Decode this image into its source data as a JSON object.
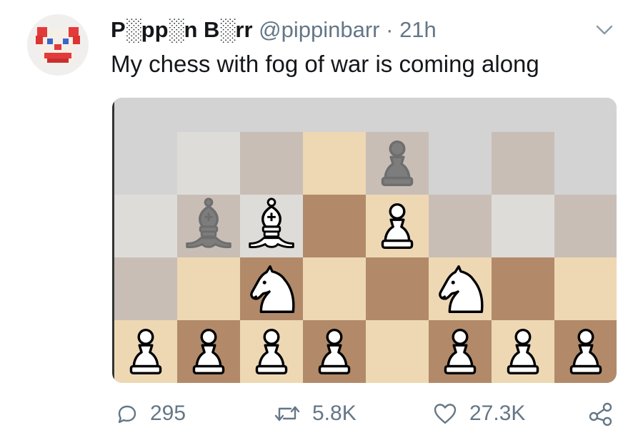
{
  "user": {
    "display_name": "P░pp░n B░rr",
    "handle": "@pippinbarr",
    "separator": "·",
    "time": "21h"
  },
  "tweet": {
    "text": "My chess with fog of war is coming along"
  },
  "board": {
    "squares": [
      [
        "fog",
        "fog",
        "fog",
        "fog",
        "fog",
        "fog",
        "fog",
        "fog"
      ],
      [
        "fog",
        "fog-light",
        "fog-dark",
        "light",
        "fog-dark",
        "fog",
        "fog-dark",
        "fog"
      ],
      [
        "fog-light",
        "fog-dark",
        "fog-light",
        "dark",
        "light",
        "fog-dark",
        "fog-light",
        "fog-dark"
      ],
      [
        "fog-dark",
        "light",
        "dark",
        "light",
        "dark",
        "light",
        "dark",
        "light"
      ],
      [
        "light",
        "dark",
        "light",
        "dark",
        "light",
        "dark",
        "light",
        "dark"
      ]
    ],
    "pieces": [
      {
        "type": "pawn",
        "color": "fogged",
        "row": 1,
        "col": 4
      },
      {
        "type": "bishop",
        "color": "fogged",
        "row": 2,
        "col": 1
      },
      {
        "type": "bishop",
        "color": "white",
        "row": 2,
        "col": 2
      },
      {
        "type": "pawn",
        "color": "white",
        "row": 2,
        "col": 4
      },
      {
        "type": "knight",
        "color": "white",
        "row": 3,
        "col": 2
      },
      {
        "type": "knight",
        "color": "white",
        "row": 3,
        "col": 5
      },
      {
        "type": "pawn",
        "color": "white",
        "row": 4,
        "col": 0
      },
      {
        "type": "pawn",
        "color": "white",
        "row": 4,
        "col": 1
      },
      {
        "type": "pawn",
        "color": "white",
        "row": 4,
        "col": 2
      },
      {
        "type": "pawn",
        "color": "white",
        "row": 4,
        "col": 3
      },
      {
        "type": "pawn",
        "color": "white",
        "row": 4,
        "col": 5
      },
      {
        "type": "pawn",
        "color": "white",
        "row": 4,
        "col": 6
      },
      {
        "type": "pawn",
        "color": "white",
        "row": 4,
        "col": 7
      }
    ],
    "colors": {
      "fog": "#d3d3d3",
      "fog-light": "#dedcd9",
      "fog-dark": "#c9beb6",
      "light": "#eed8b4",
      "dark": "#b28a69"
    }
  },
  "actions": {
    "replies": "295",
    "retweets": "5.8K",
    "likes": "27.3K"
  },
  "icons": {
    "avatar": "clown-face-avatar",
    "menu": "chevron-down-icon",
    "reply": "speech-bubble-icon",
    "retweet": "retweet-arrows-icon",
    "like": "heart-icon",
    "share": "share-icon"
  }
}
